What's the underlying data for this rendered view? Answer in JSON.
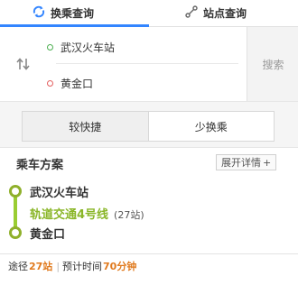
{
  "tabs": {
    "transit": {
      "label": "换乘查询",
      "icon": "transfer-icon"
    },
    "station": {
      "label": "站点查询",
      "icon": "station-route-icon"
    },
    "active_color": "#3385ff"
  },
  "search": {
    "start": "武汉火车站",
    "end": "黄金口",
    "button_label": "搜索",
    "swap_icon": "swap-vertical-icon"
  },
  "options": {
    "faster": "较快捷",
    "fewer_transfers": "少换乘",
    "selected": "较快捷"
  },
  "plan": {
    "title": "乘车方案",
    "expand_label": "展开详情",
    "expand_icon": "plus-icon",
    "start_station": "武汉火车站",
    "line_name": "轨道交通4号线",
    "line_stops": "(27站)",
    "end_station": "黄金口",
    "line_color": "#9acd32"
  },
  "summary": {
    "via_label": "途径",
    "stations": "27站",
    "time_label": "预计时间",
    "duration": "70分钟",
    "highlight_color": "#e07a1e"
  }
}
